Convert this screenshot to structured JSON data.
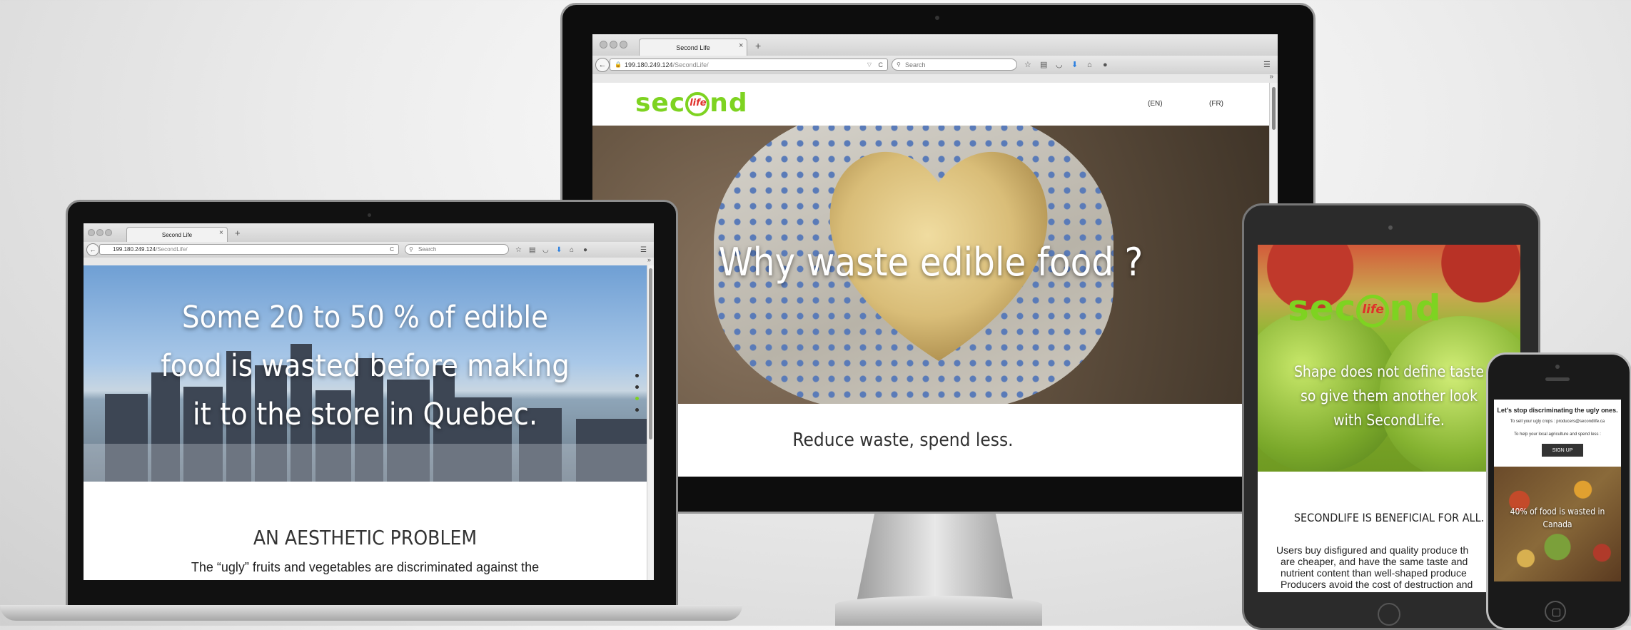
{
  "browser": {
    "tab_title": "Second Life",
    "url_host": "199.180.249.124",
    "url_path": "/SecondLife/",
    "search_placeholder": "Search",
    "new_tab": "+",
    "close_tab": "×",
    "overflow": "»",
    "reload": "C",
    "dropdown": "▽",
    "menu": "☰"
  },
  "site": {
    "logo_sec": "sec",
    "logo_nd": "nd",
    "logo_life": "life",
    "lang_en": "(EN)",
    "lang_fr": "(FR)"
  },
  "imac": {
    "hero_title": "Why waste edible food ?",
    "tagline": "Reduce waste, spend less."
  },
  "laptop": {
    "hero_line1": "Some 20 to 50 % of edible",
    "hero_line2": "food is wasted before making",
    "hero_line3": "it to the store in Quebec.",
    "section_title": "AN AESTHETIC PROBLEM",
    "section_text": "The “ugly” fruits and vegetables are discriminated against the"
  },
  "tablet": {
    "hero_line1": "Shape does not define taste",
    "hero_line2": "so give them another look",
    "hero_line3": "with SecondLife.",
    "section_title": "SECONDLIFE IS BENEFICIAL FOR ALL.",
    "text_line1": "Users buy disfigured and quality produce th",
    "text_line2": "are cheaper, and have the same taste and",
    "text_line3": "nutrient content than well-shaped produce",
    "text_line4": "Producers avoid the cost of destruction and"
  },
  "phone": {
    "heading": "Let's stop discriminating the ugly ones.",
    "line_producers": "To sell your ugly crops : producers@secondlife.ca",
    "line_help": "To help your local agriculture and spend less :",
    "signup_label": "SIGN UP",
    "hero_line1": "40% of food is wasted in",
    "hero_line2": "Canada"
  },
  "colors": {
    "brand_green": "#7ed321",
    "brand_red": "#e0302a"
  }
}
